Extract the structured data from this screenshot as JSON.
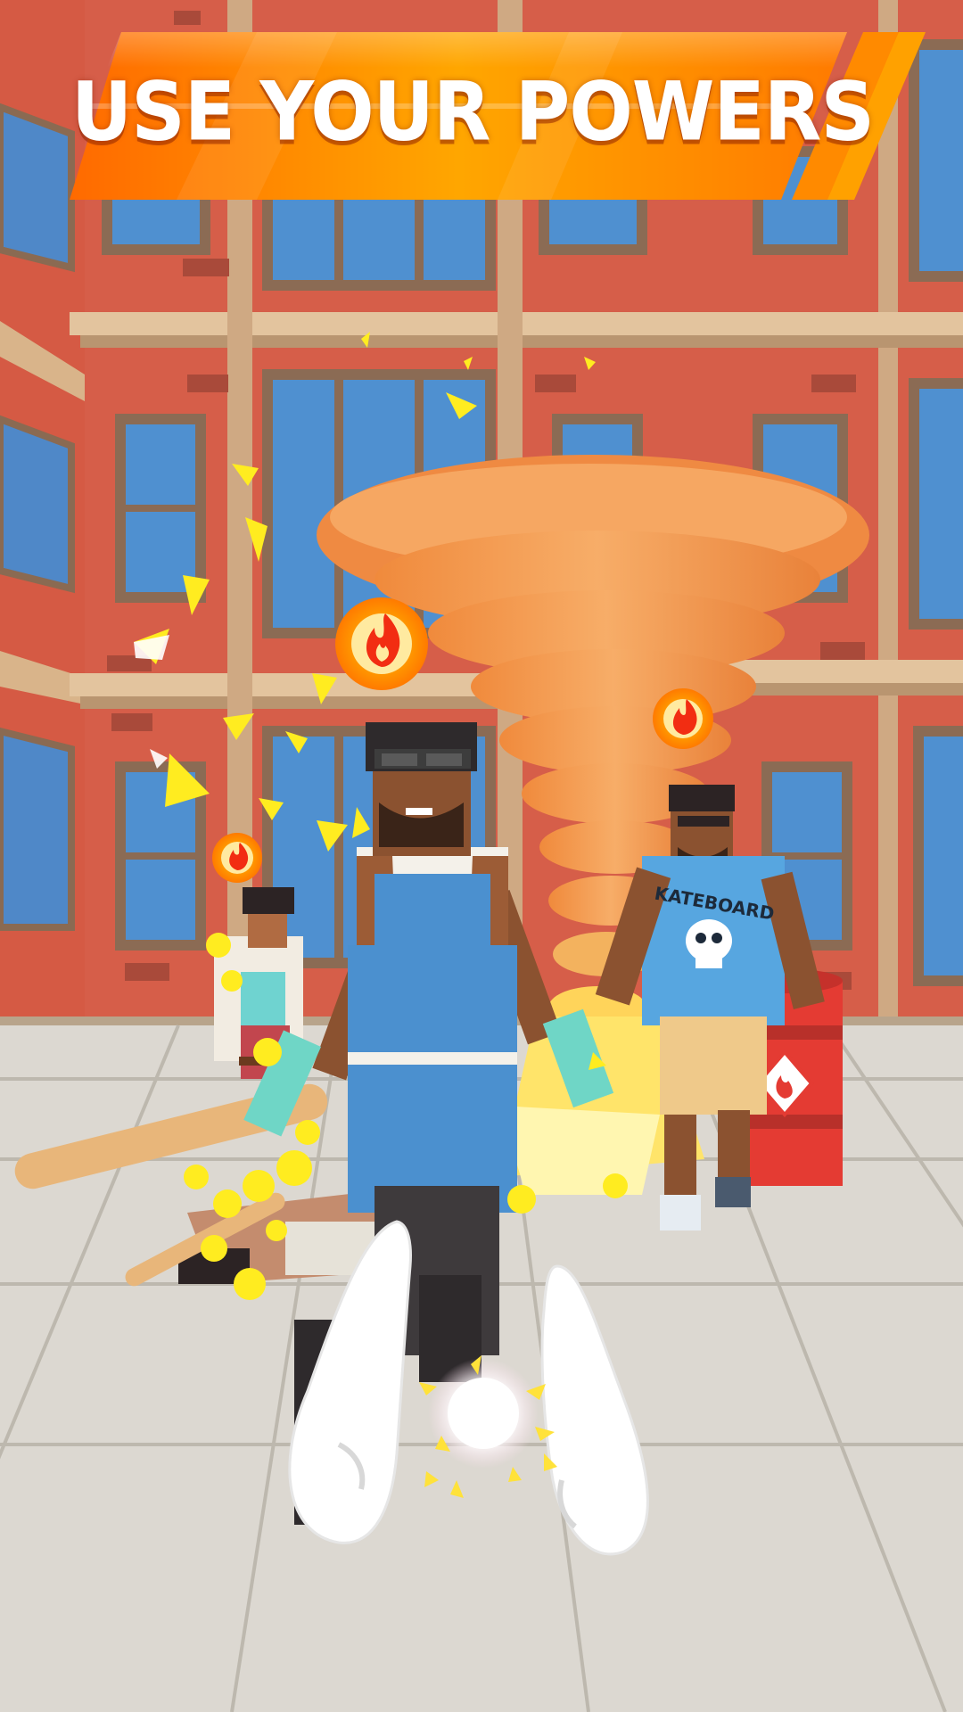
{
  "banner": {
    "text": "USE YOUR POWERS"
  },
  "scene": {
    "setting": "city street with red brick buildings",
    "enemies": [
      {
        "name": "apron-thug",
        "status_icon": "fire-icon"
      },
      {
        "name": "skateboard-shirt-thug",
        "status_icon": "fire-icon",
        "shirt_text": "KATEBOARD"
      },
      {
        "name": "woman-thug",
        "status_icon": "fire-icon"
      }
    ],
    "power": "tornado",
    "barrel_icon": "flammable-hazard-icon"
  },
  "colors": {
    "banner_orange": "#ff7a00",
    "banner_yellow": "#ffb400",
    "brick": "#d9604a",
    "tornado": "#f7a055",
    "fire_ring": "#ff9a00"
  }
}
